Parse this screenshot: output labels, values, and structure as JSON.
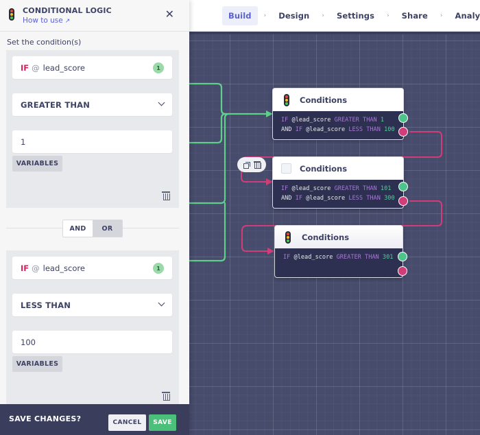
{
  "panel": {
    "title": "CONDITIONAL LOGIC",
    "icon": "traffic-light-icon",
    "help_link": "How to use",
    "help_link_icon": "external-link-icon",
    "close_icon": "close-icon",
    "section_label": "Set the condition(s)",
    "conditions": [
      {
        "if_keyword": "IF",
        "at_symbol": "@",
        "variable": "lead_score",
        "badge": "1",
        "operator": "GREATER THAN",
        "value": "1",
        "variables_button": "VARIABLES",
        "delete_icon": "trash-icon"
      },
      {
        "if_keyword": "IF",
        "at_symbol": "@",
        "variable": "lead_score",
        "badge": "1",
        "operator": "LESS THAN",
        "value": "100",
        "variables_button": "VARIABLES",
        "delete_icon": "trash-icon"
      }
    ],
    "logic_toggle": {
      "options": [
        "AND",
        "OR"
      ],
      "selected": "AND"
    },
    "footer": {
      "label": "SAVE CHANGES?",
      "cancel": "CANCEL",
      "save": "SAVE"
    }
  },
  "nav": {
    "steps": [
      {
        "label": "Build",
        "active": true
      },
      {
        "label": "Design",
        "active": false
      },
      {
        "label": "Settings",
        "active": false
      },
      {
        "label": "Share",
        "active": false
      },
      {
        "label": "Analyze",
        "active": false
      }
    ],
    "separator": "›"
  },
  "canvas": {
    "nodes": [
      {
        "title": "Conditions",
        "icon": "traffic-light-icon",
        "lines": [
          [
            {
              "t": "IF",
              "c": "kw"
            },
            {
              "t": " @lead_score ",
              "c": ""
            },
            {
              "t": "GREATER THAN",
              "c": "kw"
            },
            {
              "t": " ",
              "c": ""
            },
            {
              "t": "1",
              "c": "num"
            }
          ],
          [
            {
              "t": "AND ",
              "c": ""
            },
            {
              "t": "IF",
              "c": "kw"
            },
            {
              "t": " @lead_score ",
              "c": ""
            },
            {
              "t": "LESS THAN",
              "c": "kw"
            },
            {
              "t": " ",
              "c": ""
            },
            {
              "t": "100",
              "c": "num"
            }
          ]
        ]
      },
      {
        "title": "Conditions",
        "icon": "checkbox-icon",
        "lines": [
          [
            {
              "t": "IF",
              "c": "kw"
            },
            {
              "t": " @lead_score ",
              "c": ""
            },
            {
              "t": "GREATER THAN",
              "c": "kw"
            },
            {
              "t": " ",
              "c": ""
            },
            {
              "t": "101",
              "c": "num"
            }
          ],
          [
            {
              "t": "AND ",
              "c": ""
            },
            {
              "t": "IF",
              "c": "kw"
            },
            {
              "t": " @lead_score ",
              "c": ""
            },
            {
              "t": "LESS THAN",
              "c": "kw"
            },
            {
              "t": " ",
              "c": ""
            },
            {
              "t": "300",
              "c": "num"
            }
          ]
        ]
      },
      {
        "title": "Conditions",
        "icon": "traffic-light-icon",
        "lines": [
          [
            {
              "t": "IF",
              "c": "kw"
            },
            {
              "t": " @lead_score ",
              "c": ""
            },
            {
              "t": "GREATER THAN",
              "c": "kw"
            },
            {
              "t": " ",
              "c": ""
            },
            {
              "t": "301",
              "c": "num"
            }
          ]
        ]
      }
    ],
    "node_toolbar": {
      "copy_icon": "copy-icon",
      "delete_icon": "trash-icon"
    }
  },
  "colors": {
    "accent": "#5b61d1",
    "if_keyword": "#d4225c",
    "true_port": "#4cc48c",
    "false_port": "#d03d78",
    "save": "#4cbf7a",
    "canvas": "#474c6c"
  }
}
